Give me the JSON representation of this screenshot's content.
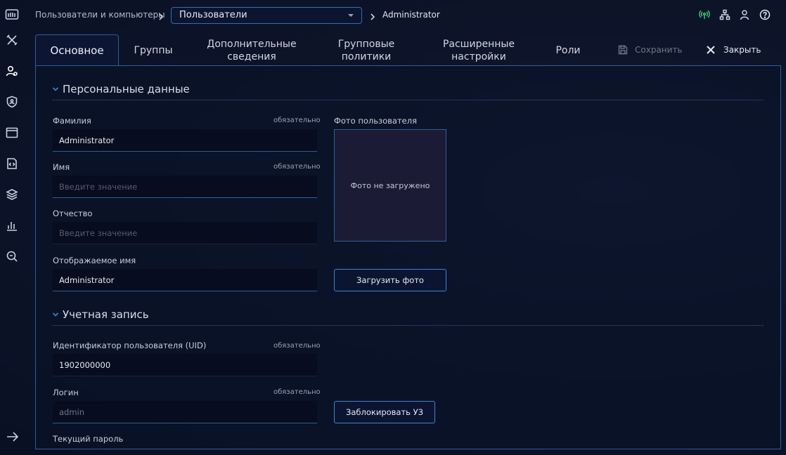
{
  "breadcrumb": {
    "root": "Пользователи и компьютеры",
    "selected": "Пользователи",
    "current": "Administrator"
  },
  "tabs": [
    {
      "label": "Основное"
    },
    {
      "label": "Группы"
    },
    {
      "label": "Дополнительные сведения"
    },
    {
      "label": "Групповые политики"
    },
    {
      "label": "Расширенные настройки"
    },
    {
      "label": "Роли"
    }
  ],
  "toolbar": {
    "save_label": "Сохранить",
    "close_label": "Закрыть"
  },
  "personal": {
    "title": "Персональные данные",
    "required_label": "обязательно",
    "surname_label": "Фамилия",
    "surname_value": "Administrator",
    "name_label": "Имя",
    "name_placeholder": "Введите значение",
    "patronymic_label": "Отчество",
    "patronymic_placeholder": "Введите значение",
    "display_label": "Отображаемое имя",
    "display_value": "Administrator",
    "photo_label": "Фото пользователя",
    "photo_empty": "Фото не загружено",
    "upload_label": "Загрузить фото"
  },
  "account": {
    "title": "Учетная запись",
    "uid_label": "Идентификатор пользователя (UID)",
    "uid_value": "1902000000",
    "login_label": "Логин",
    "login_value": "admin",
    "lock_label": "Заблокировать УЗ",
    "password_label": "Текущий пароль"
  },
  "colors": {
    "accent": "#2f6fb5",
    "status_green": "#3ec46d"
  }
}
